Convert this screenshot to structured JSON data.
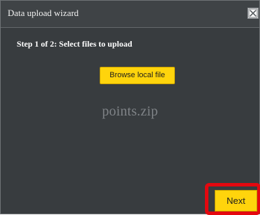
{
  "dialog": {
    "title": "Data upload wizard",
    "close_icon": "close-icon",
    "step_heading": "Step 1 of 2: Select files to upload",
    "browse_label": "Browse local file",
    "selected_file": "points.zip",
    "next_label": "Next"
  },
  "colors": {
    "dialog_background": "#383c3f",
    "button_yellow": "#ffd40c",
    "highlight_red": "#e4080f",
    "filename_gray": "#7f8387"
  }
}
